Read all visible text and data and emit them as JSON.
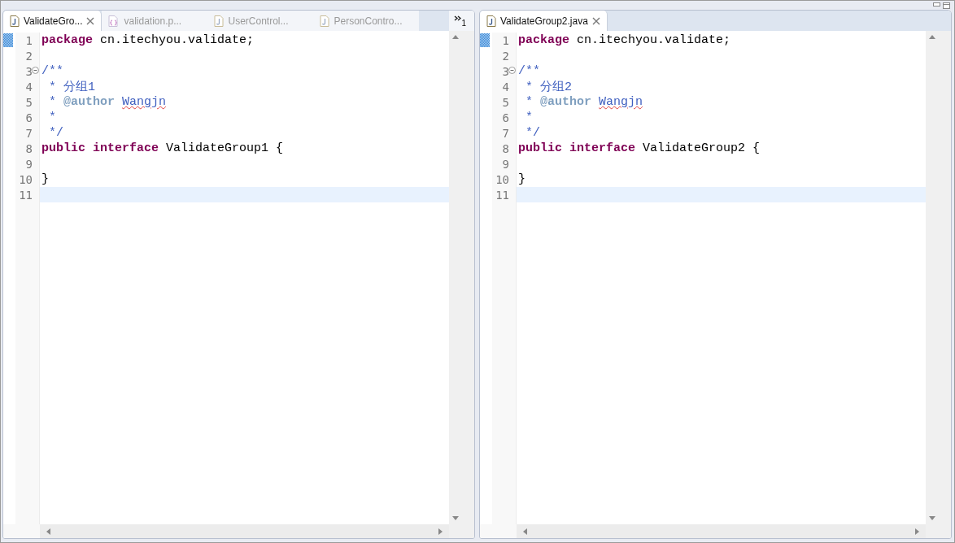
{
  "editors": [
    {
      "tabs": [
        {
          "label": "ValidateGro...",
          "kind": "java",
          "selected": true
        },
        {
          "label": "validation.p...",
          "kind": "properties",
          "selected": false
        },
        {
          "label": "UserControl...",
          "kind": "java",
          "selected": false
        },
        {
          "label": "PersonContro...",
          "kind": "java",
          "selected": false
        }
      ],
      "overflow_count": "1",
      "lines": [
        {
          "number": "1",
          "marked": true,
          "foldable": false,
          "current": false,
          "tokens": [
            {
              "kind": "keyword",
              "text": "package"
            },
            {
              "kind": "plain",
              "text": " cn.itechyou.validate;"
            }
          ]
        },
        {
          "number": "2",
          "marked": false,
          "foldable": false,
          "current": false
        },
        {
          "number": "3",
          "marked": false,
          "foldable": true,
          "current": false,
          "tokens": [
            {
              "kind": "doc",
              "text": "/**"
            }
          ]
        },
        {
          "number": "4",
          "marked": false,
          "foldable": false,
          "current": false,
          "tokens": [
            {
              "kind": "doc",
              "text": " * 分组1"
            }
          ]
        },
        {
          "number": "5",
          "marked": false,
          "foldable": false,
          "current": false,
          "tokens": [
            {
              "kind": "doc",
              "text": " * "
            },
            {
              "kind": "doctag",
              "text": "@author "
            },
            {
              "kind": "misspelled",
              "text": "Wangjn"
            }
          ]
        },
        {
          "number": "6",
          "marked": false,
          "foldable": false,
          "current": false,
          "tokens": [
            {
              "kind": "doc",
              "text": " *"
            }
          ]
        },
        {
          "number": "7",
          "marked": false,
          "foldable": false,
          "current": false,
          "tokens": [
            {
              "kind": "doc",
              "text": " */"
            }
          ]
        },
        {
          "number": "8",
          "marked": false,
          "foldable": false,
          "current": false,
          "tokens": [
            {
              "kind": "keyword",
              "text": "public "
            },
            {
              "kind": "keyword",
              "text": "interface"
            },
            {
              "kind": "plain",
              "text": " ValidateGroup1 {"
            }
          ]
        },
        {
          "number": "9",
          "marked": false,
          "foldable": false,
          "current": false
        },
        {
          "number": "10",
          "marked": false,
          "foldable": false,
          "current": false,
          "tokens": [
            {
              "kind": "plain",
              "text": "}"
            }
          ]
        },
        {
          "number": "11",
          "marked": false,
          "foldable": false,
          "current": true
        }
      ]
    },
    {
      "tabs": [
        {
          "label": "ValidateGroup2.java",
          "kind": "java",
          "selected": true
        }
      ],
      "lines": [
        {
          "number": "1",
          "marked": true,
          "foldable": false,
          "current": false,
          "tokens": [
            {
              "kind": "keyword",
              "text": "package"
            },
            {
              "kind": "plain",
              "text": " cn.itechyou.validate;"
            }
          ]
        },
        {
          "number": "2",
          "marked": false,
          "foldable": false,
          "current": false
        },
        {
          "number": "3",
          "marked": false,
          "foldable": true,
          "current": false,
          "tokens": [
            {
              "kind": "doc",
              "text": "/**"
            }
          ]
        },
        {
          "number": "4",
          "marked": false,
          "foldable": false,
          "current": false,
          "tokens": [
            {
              "kind": "doc",
              "text": " * 分组2"
            }
          ]
        },
        {
          "number": "5",
          "marked": false,
          "foldable": false,
          "current": false,
          "tokens": [
            {
              "kind": "doc",
              "text": " * "
            },
            {
              "kind": "doctag",
              "text": "@author "
            },
            {
              "kind": "misspelled",
              "text": "Wangjn"
            }
          ]
        },
        {
          "number": "6",
          "marked": false,
          "foldable": false,
          "current": false,
          "tokens": [
            {
              "kind": "doc",
              "text": " *"
            }
          ]
        },
        {
          "number": "7",
          "marked": false,
          "foldable": false,
          "current": false,
          "tokens": [
            {
              "kind": "doc",
              "text": " */"
            }
          ]
        },
        {
          "number": "8",
          "marked": false,
          "foldable": false,
          "current": false,
          "tokens": [
            {
              "kind": "keyword",
              "text": "public "
            },
            {
              "kind": "keyword",
              "text": "interface"
            },
            {
              "kind": "plain",
              "text": " ValidateGroup2 {"
            }
          ]
        },
        {
          "number": "9",
          "marked": false,
          "foldable": false,
          "current": false
        },
        {
          "number": "10",
          "marked": false,
          "foldable": false,
          "current": false,
          "tokens": [
            {
              "kind": "plain",
              "text": "}"
            }
          ]
        },
        {
          "number": "11",
          "marked": false,
          "foldable": false,
          "current": true
        }
      ]
    }
  ]
}
